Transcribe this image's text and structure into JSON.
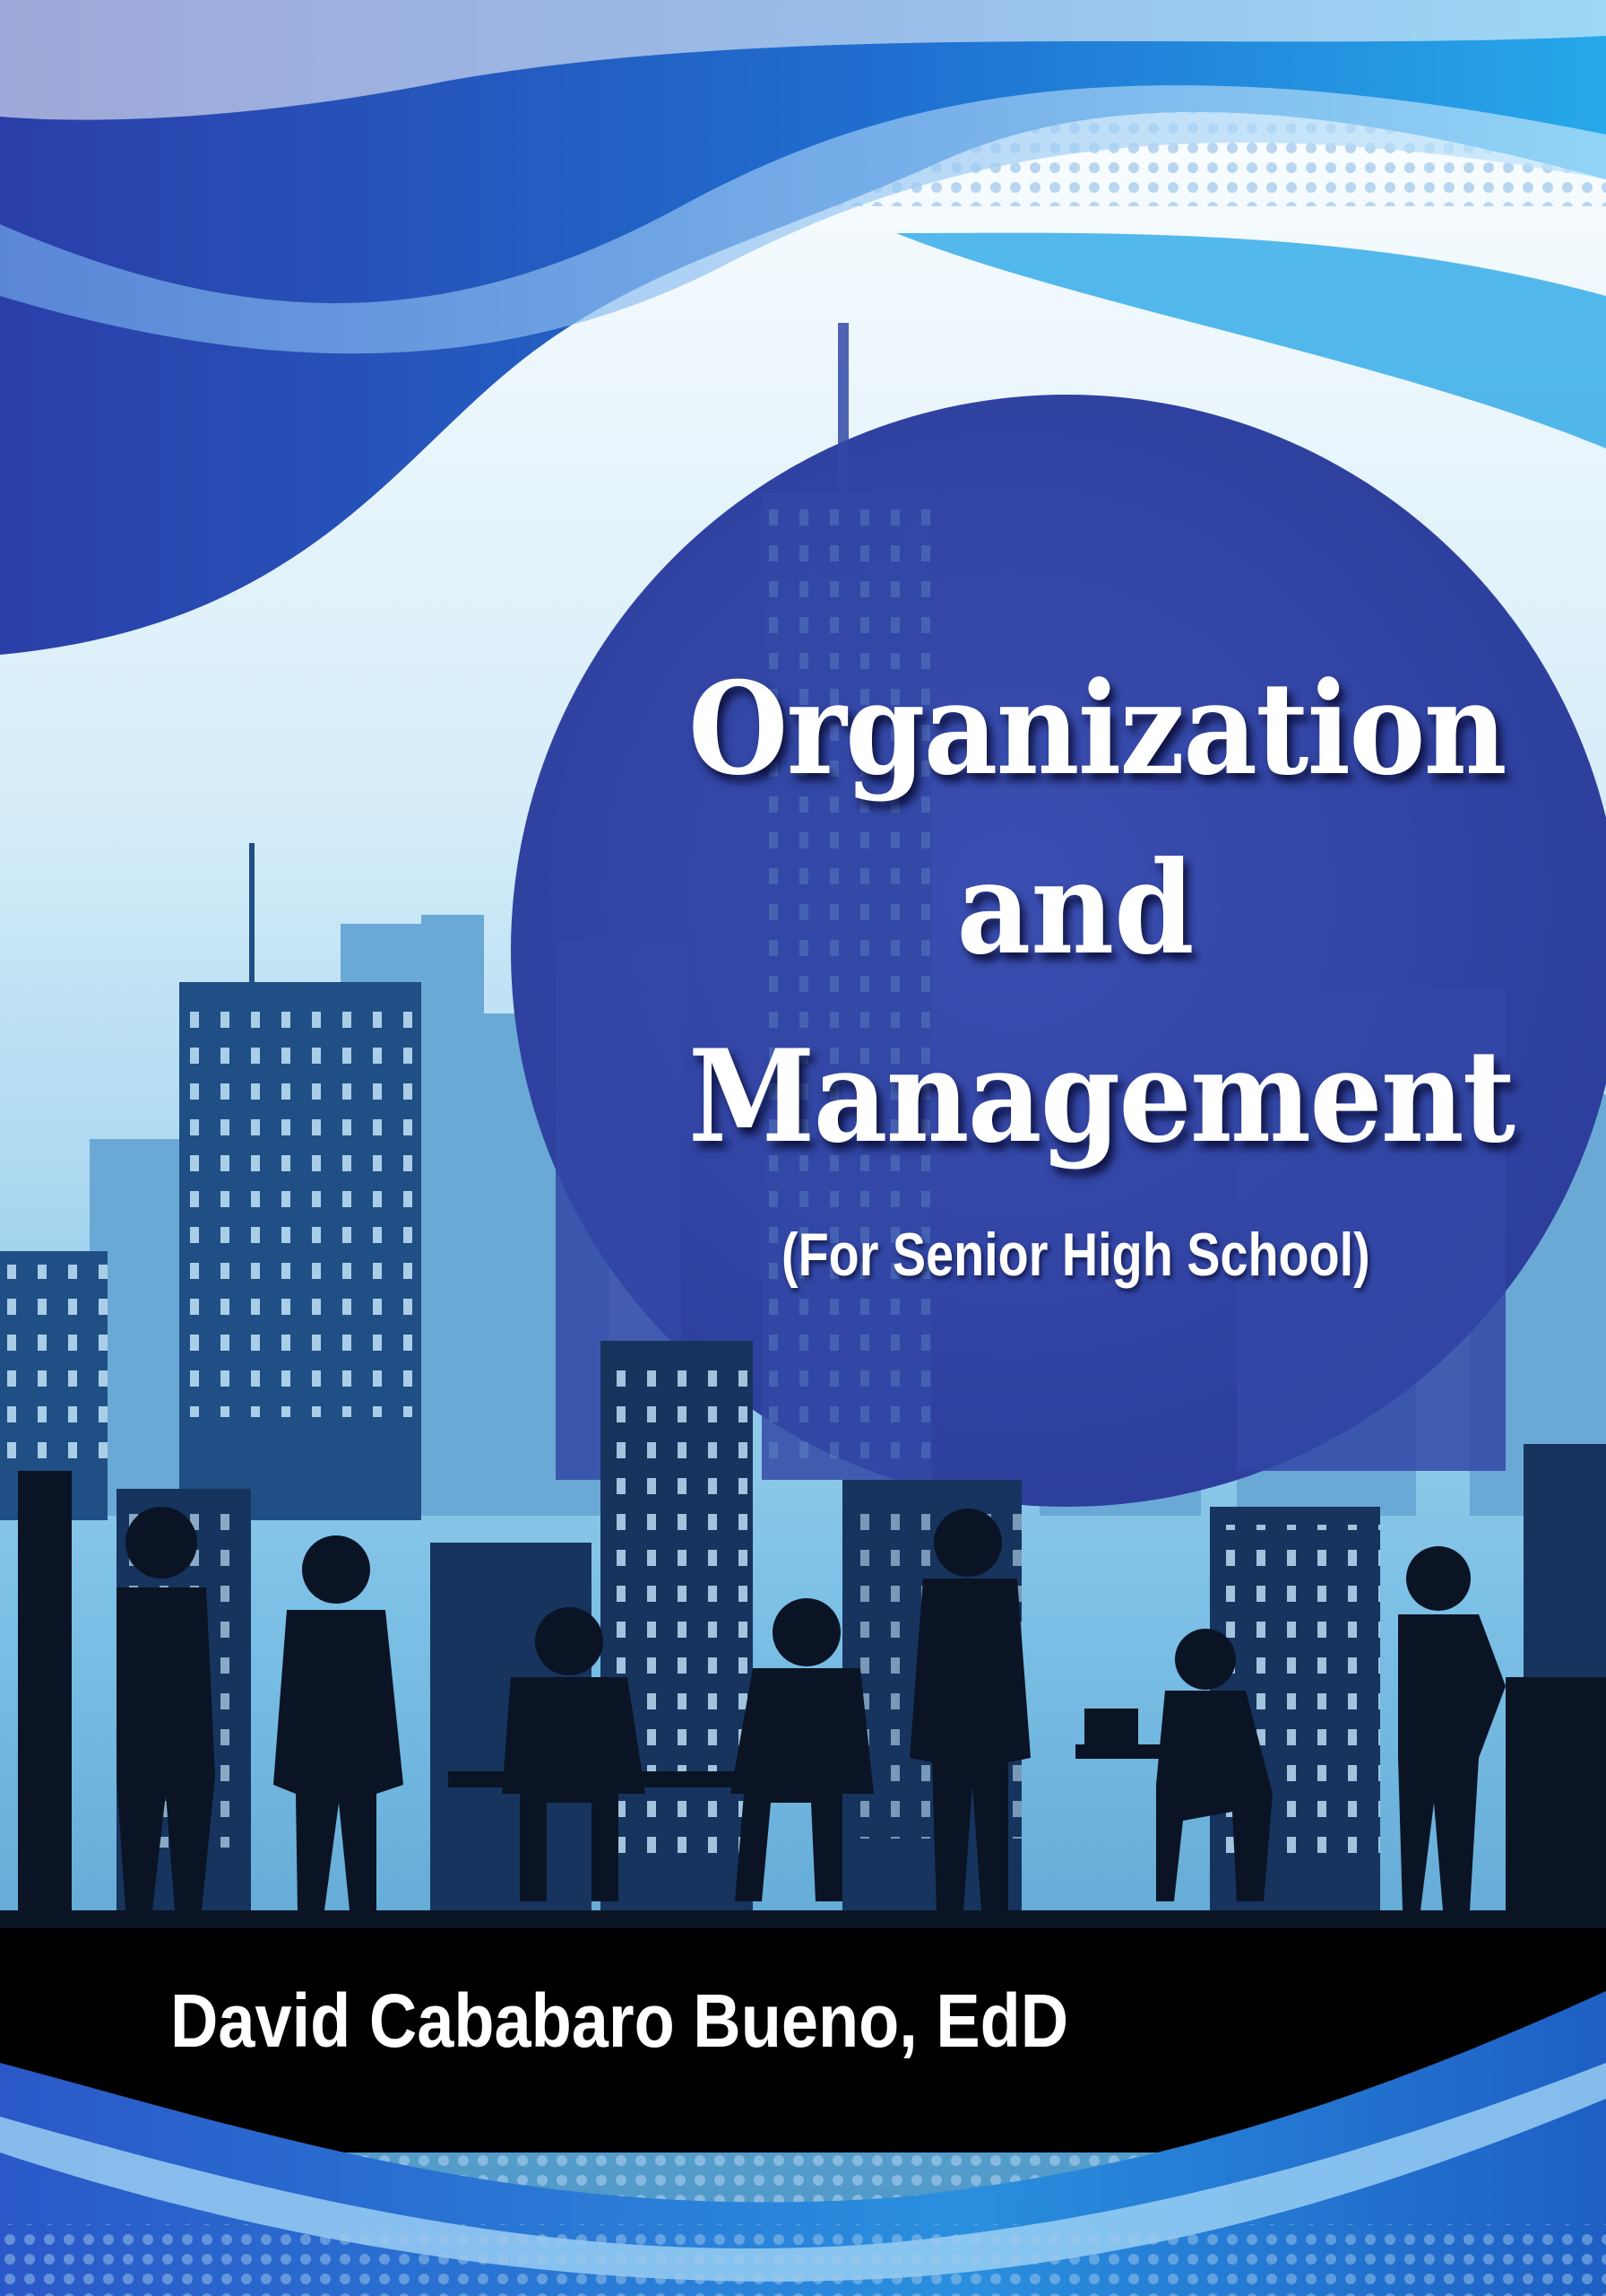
{
  "cover": {
    "title_lines": [
      "Organization",
      "and",
      "Management"
    ],
    "subtitle": "(For Senior High School)",
    "author": "David Cababaro Bueno, EdD"
  },
  "colors": {
    "deep_blue": "#2f3f9e",
    "sky_blue": "#2aa7e6",
    "light_sky": "#cfeaf8",
    "silhouette": "#0a1424"
  },
  "illustration_icons": [
    "city-skyline",
    "office-worker-silhouettes",
    "wave-swoosh",
    "halftone-dots"
  ]
}
